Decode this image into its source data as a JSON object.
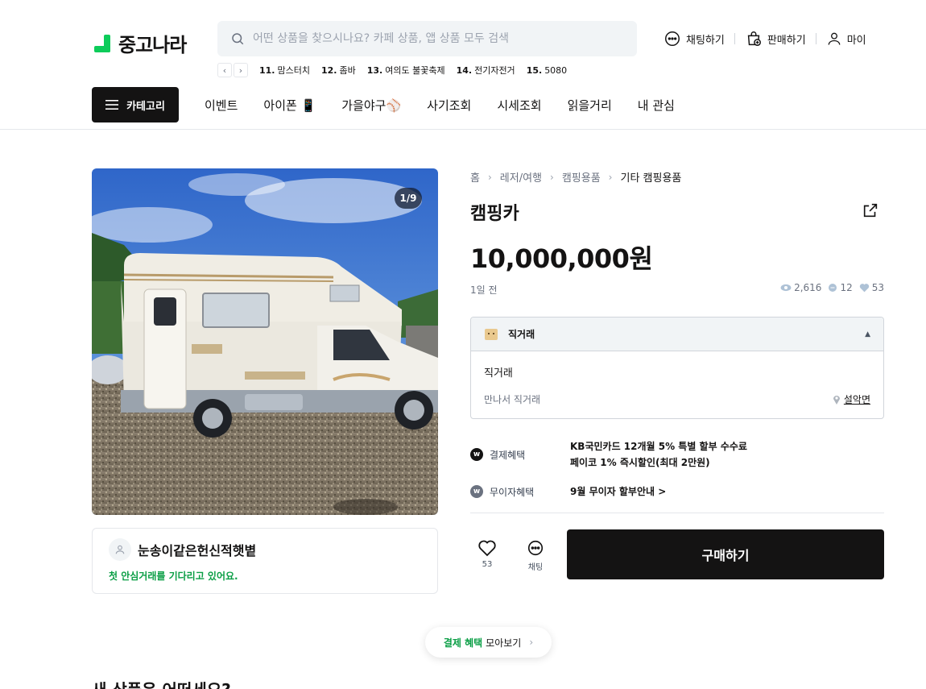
{
  "header": {
    "logo_text": "중고나라",
    "search_placeholder": "어떤 상품을 찾으시나요? 카페 상품, 앱 상품 모두 검색",
    "actions": {
      "chat": "채팅하기",
      "sell": "판매하기",
      "my": "마이"
    },
    "keywords": [
      {
        "rank": "11.",
        "text": "맘스터치"
      },
      {
        "rank": "12.",
        "text": "좀바"
      },
      {
        "rank": "13.",
        "text": "여의도 불꽃축제"
      },
      {
        "rank": "14.",
        "text": "전기자전거"
      },
      {
        "rank": "15.",
        "text": "5080"
      }
    ]
  },
  "nav": {
    "category_label": "카테고리",
    "items": [
      "이벤트",
      "아이폰 📱",
      "가을야구⚾",
      "사기조회",
      "시세조회",
      "읽을거리",
      "내 관심"
    ]
  },
  "product": {
    "image_counter": "1/9",
    "breadcrumbs": [
      "홈",
      "레저/여행",
      "캠핑용품",
      "기타 캠핑용품"
    ],
    "title": "캠핑카",
    "price": "10,000,000원",
    "posted": "1일 전",
    "stats": {
      "views": "2,616",
      "chats": "12",
      "likes": "53"
    }
  },
  "deal": {
    "header_label": "직거래",
    "type": "직거래",
    "desc": "만나서 직거래",
    "location": "설악면"
  },
  "benefits": {
    "payment": {
      "label": "결제혜택",
      "line1": "KB국민카드 12개월 5% 특별 할부 수수료",
      "line2": "페이코 1% 즉시할인(최대 2만원)"
    },
    "interest_free": {
      "label": "무이자혜택",
      "text": "9월 무이자 할부안내 >"
    }
  },
  "actions": {
    "like_count": "53",
    "chat_label": "채팅",
    "buy_label": "구매하기"
  },
  "seller": {
    "name": "눈송이같은헌신적햇볕",
    "note": "첫 안심거래를 기다리고 있어요."
  },
  "promo": {
    "highlight": "결제 혜택",
    "rest": "모아보기"
  },
  "section_heading": "새 상품은 어떠세요?",
  "colors": {
    "brand_green": "#0dcc5a",
    "dark": "#141313",
    "note_green": "#0a9e45"
  }
}
